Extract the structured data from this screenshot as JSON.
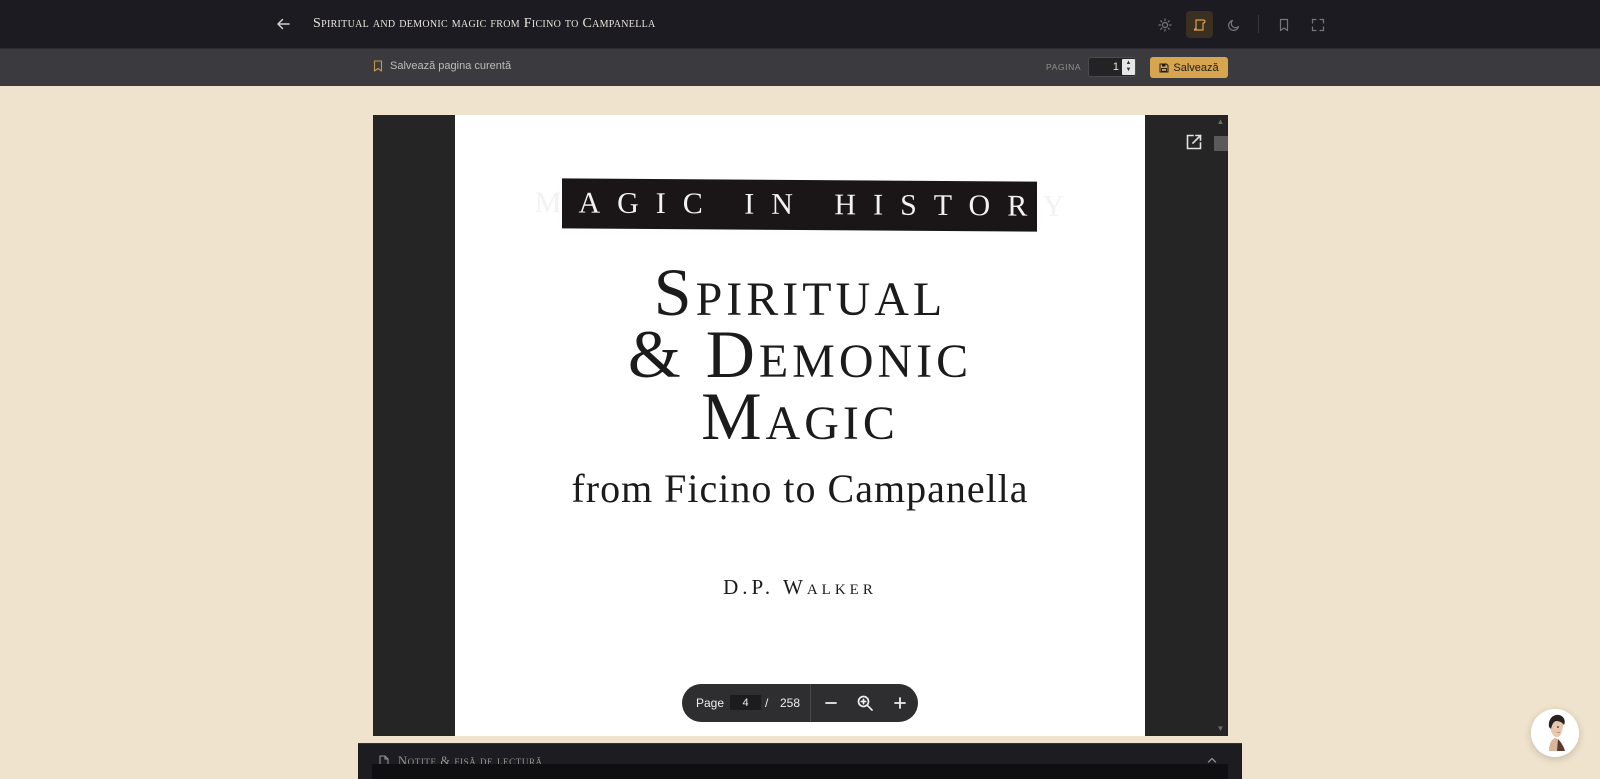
{
  "header": {
    "title": "Spiritual and demonic magic from Ficino to Campanella",
    "icons": [
      "back-arrow-icon",
      "sun-icon",
      "scroll-icon",
      "moon-icon",
      "bookmark-icon",
      "fullscreen-icon"
    ],
    "accent": "#d8a24a"
  },
  "subbar": {
    "save_current_label": "Salvează pagina curentă",
    "pagina_label": "PAGINA",
    "page_value": "1",
    "save_button_label": "Salvează"
  },
  "cover": {
    "series": "MAGIC IN HISTORY",
    "title_line1": "Spiritual",
    "title_line2": "& Demonic",
    "title_line3": "Magic",
    "subtitle": "from Ficino to Campanella",
    "author": "D.P. Walker"
  },
  "pdf_toolbar": {
    "page_label": "Page",
    "current_page": "4",
    "separator": "/",
    "total_pages": "258"
  },
  "notes": {
    "label": "Notițe & fișă de lectură"
  },
  "colors": {
    "background": "#efe3cd",
    "topbar": "#1c1b21",
    "subbar": "#3b3b3f",
    "save_button": "#d7a44f"
  }
}
